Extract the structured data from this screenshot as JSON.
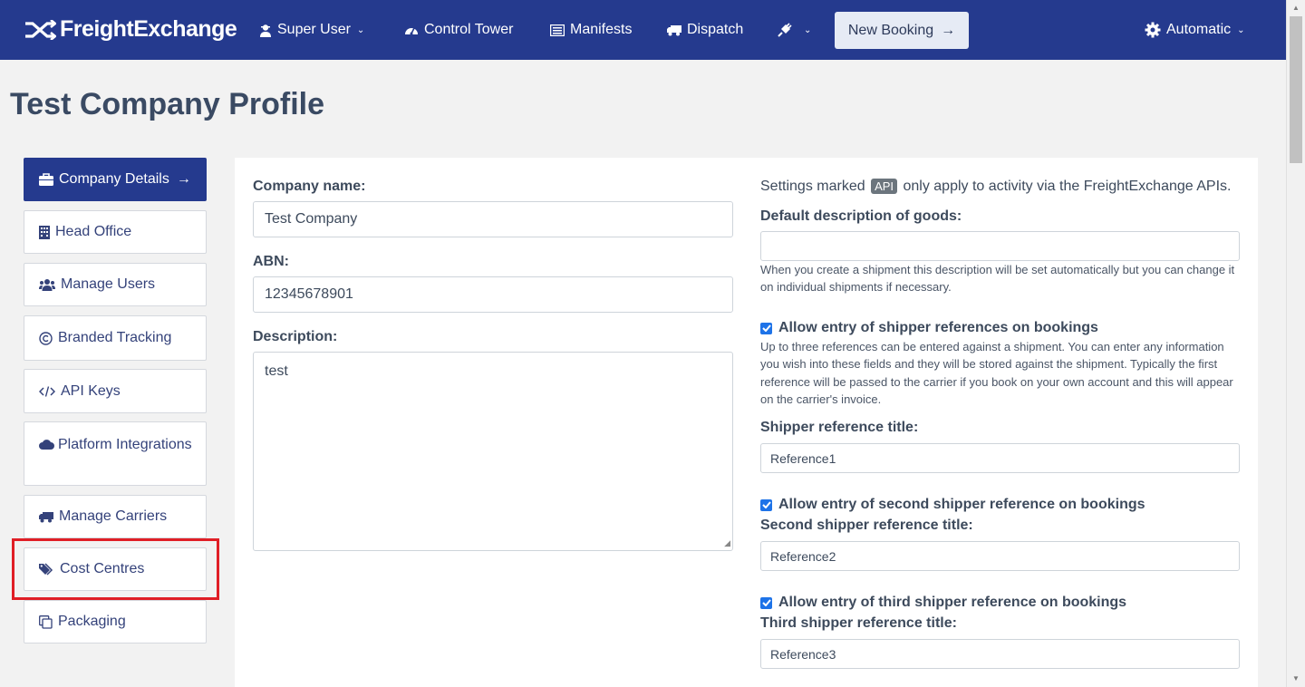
{
  "nav": {
    "logo": "FreightExchange",
    "super_user": "Super User",
    "control_tower": "Control Tower",
    "manifests": "Manifests",
    "dispatch": "Dispatch",
    "new_booking": "New Booking",
    "new_booking_arrow": "→",
    "automatic": "Automatic"
  },
  "page": {
    "title": "Test Company Profile"
  },
  "sidebar": {
    "items": [
      {
        "label": "Company Details",
        "icon": "briefcase-icon",
        "active": true
      },
      {
        "label": "Head Office",
        "icon": "building-icon"
      },
      {
        "label": "Manage Users",
        "icon": "users-icon"
      },
      {
        "label": "Branded Tracking",
        "icon": "copyright-icon"
      },
      {
        "label": "API Keys",
        "icon": "code-icon"
      },
      {
        "label": "Platform Integrations",
        "icon": "cloud-icon"
      },
      {
        "label": "Manage Carriers",
        "icon": "truck-icon"
      },
      {
        "label": "Cost Centres",
        "icon": "tags-icon"
      },
      {
        "label": "Packaging",
        "icon": "copy-icon"
      }
    ],
    "active_arrow": "→"
  },
  "form": {
    "company_name_label": "Company name:",
    "company_name_value": "Test Company",
    "abn_label": "ABN:",
    "abn_value": "12345678901",
    "description_label": "Description:",
    "description_value": "test",
    "settings_prefix": "Settings marked",
    "api_badge": "API",
    "settings_suffix": "only apply to activity via the FreightExchange APIs.",
    "default_desc_label": "Default description of goods:",
    "default_desc_value": "",
    "default_desc_help": "When you create a shipment this description will be set automatically but you can change it on individual shipments if necessary.",
    "allow_ref1_label": "Allow entry of shipper references on bookings",
    "allow_ref1_checked": true,
    "allow_ref1_help": "Up to three references can be entered against a shipment. You can enter any information you wish into these fields and they will be stored against the shipment. Typically the first reference will be passed to the carrier if you book on your own account and this will appear on the carrier's invoice.",
    "ref1_title_label": "Shipper reference title:",
    "ref1_title_value": "Reference1",
    "allow_ref2_label": "Allow entry of second shipper reference on bookings",
    "allow_ref2_checked": true,
    "ref2_title_label": "Second shipper reference title:",
    "ref2_title_value": "Reference2",
    "allow_ref3_label": "Allow entry of third shipper reference on bookings",
    "allow_ref3_checked": true,
    "ref3_title_label": "Third shipper reference title:",
    "ref3_title_value": "Reference3"
  },
  "colors": {
    "nav_bg": "#253a8e",
    "highlight": "#e01e26",
    "checkbox": "#1e73e8"
  }
}
